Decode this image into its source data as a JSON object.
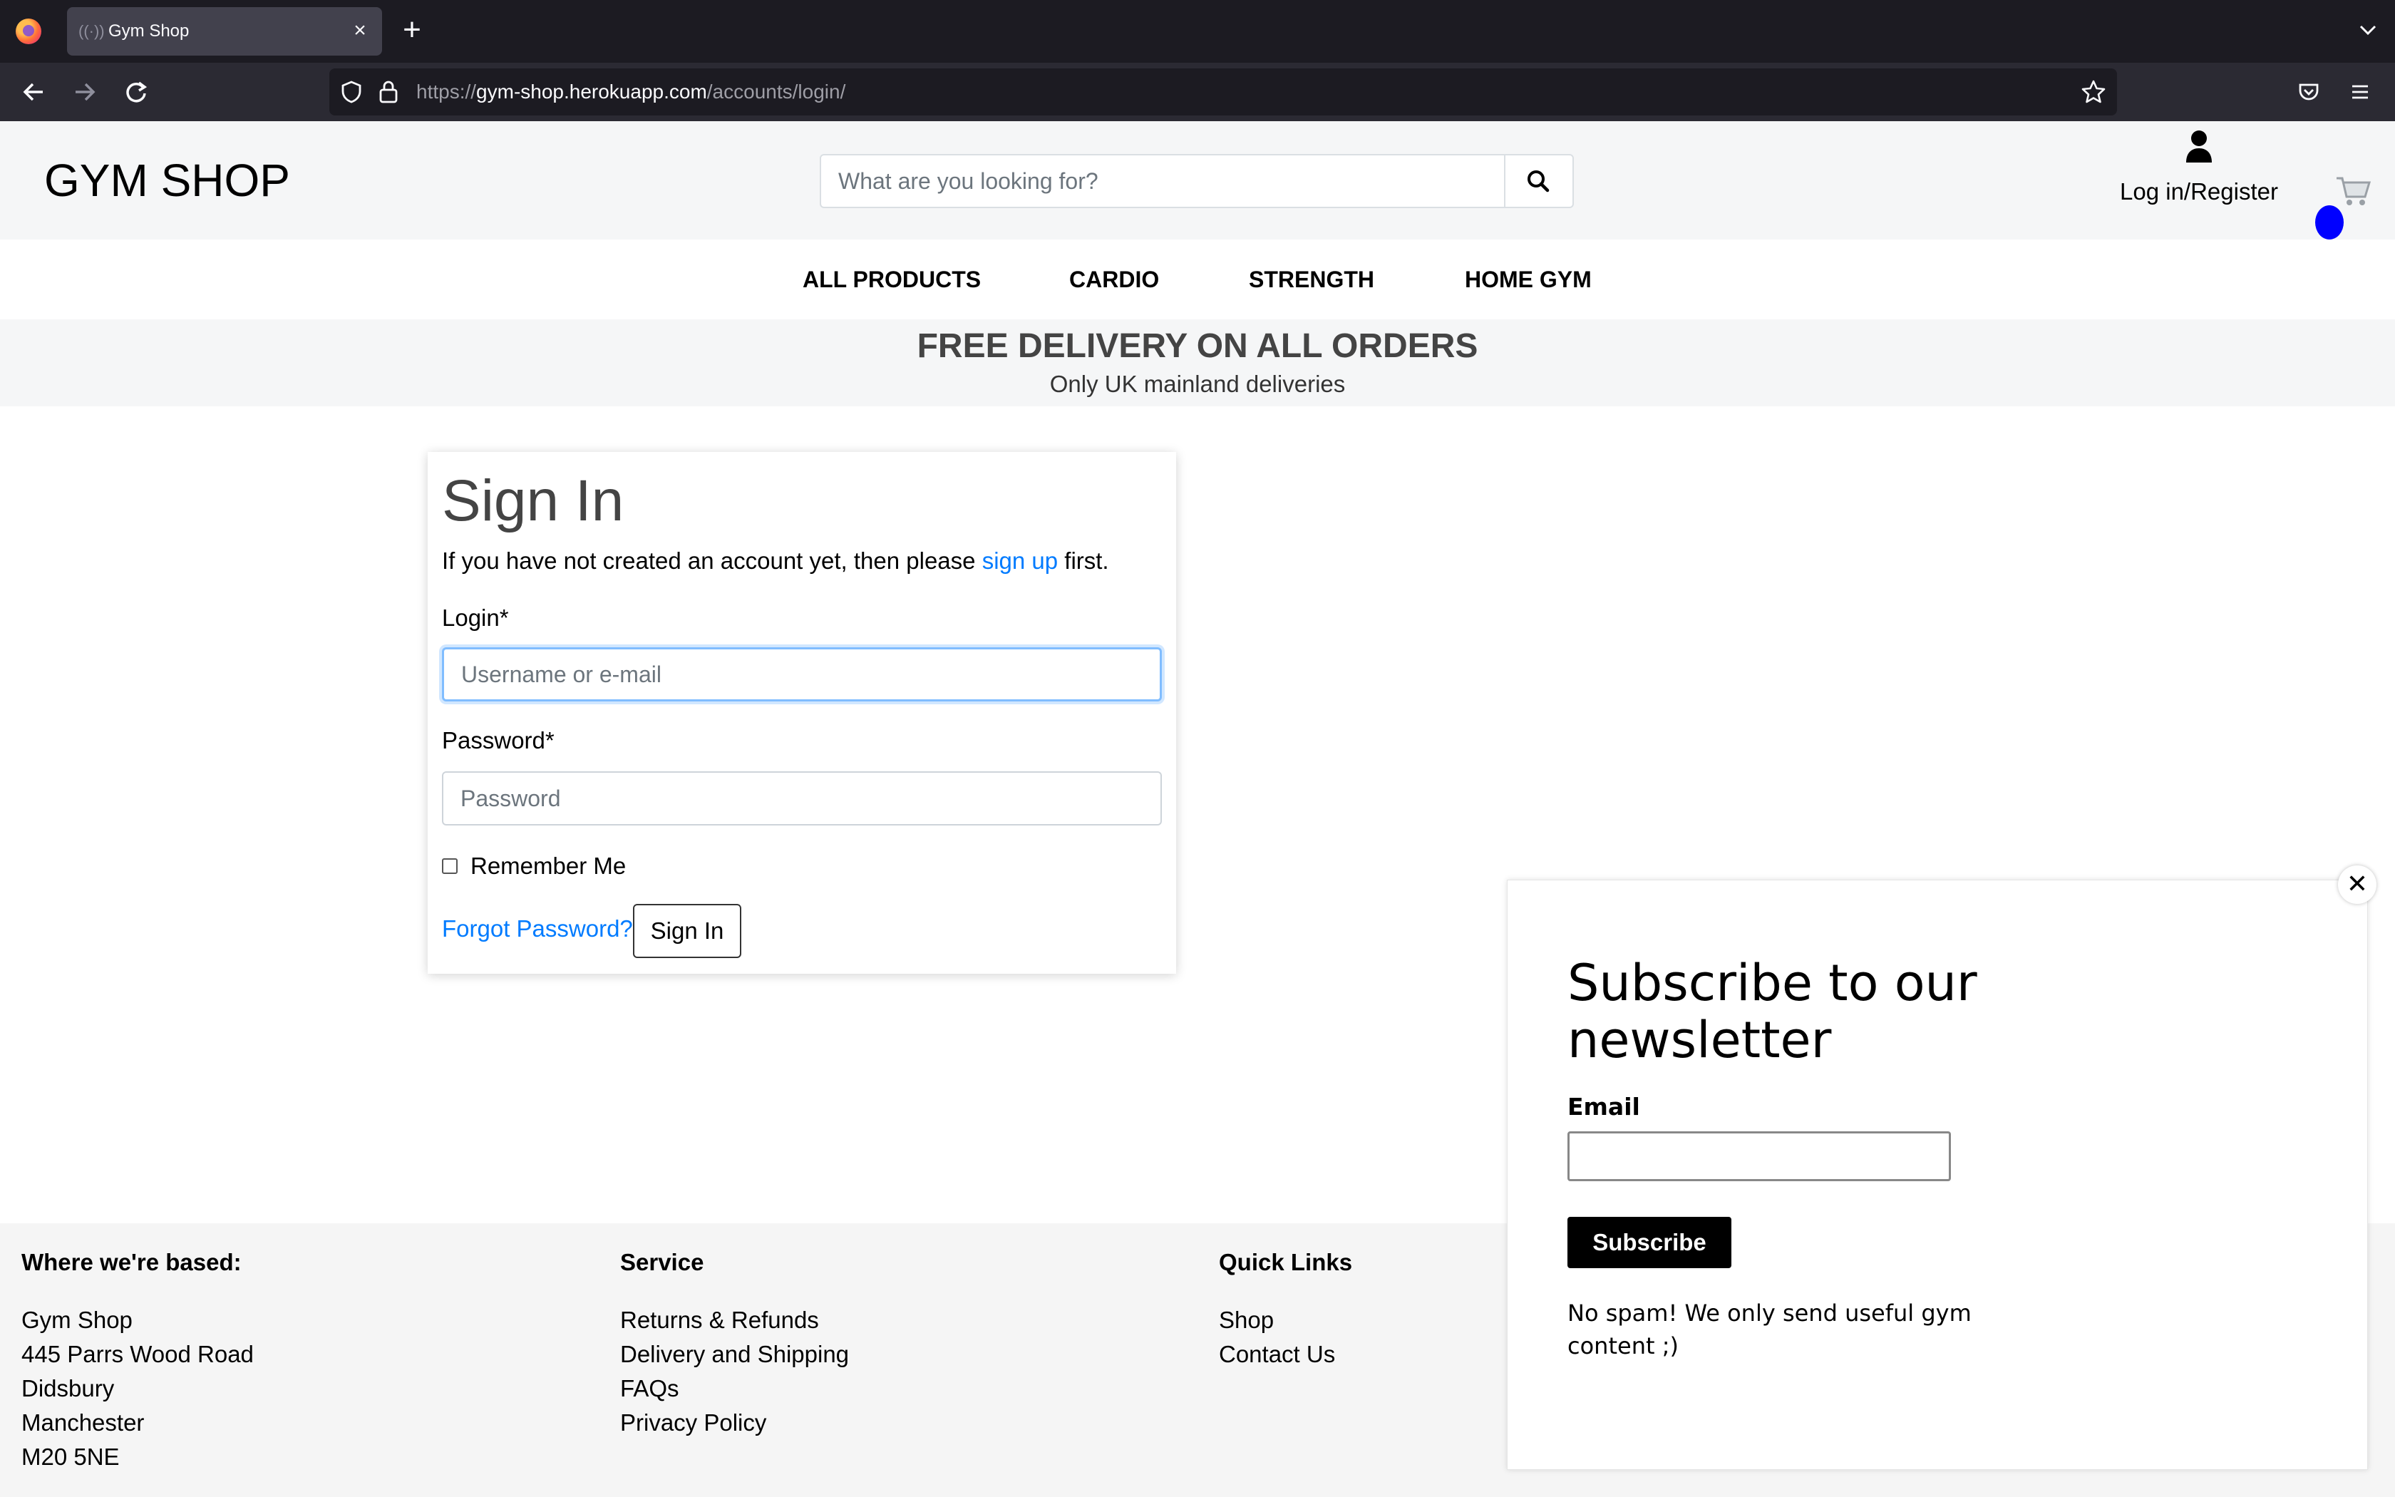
{
  "browser": {
    "tab_title": "Gym Shop",
    "url_prefix": "https://",
    "url_domain": "gym-shop.herokuapp.com",
    "url_path": "/accounts/login/"
  },
  "header": {
    "logo": "GYM SHOP",
    "search_placeholder": "What are you looking for?",
    "account_label": "Log in/Register"
  },
  "nav": {
    "items": [
      "ALL PRODUCTS",
      "CARDIO",
      "STRENGTH",
      "HOME GYM"
    ]
  },
  "banner": {
    "title": "FREE DELIVERY ON ALL ORDERS",
    "subtitle": "Only UK mainland deliveries"
  },
  "signin": {
    "title": "Sign In",
    "intro_before": "If you have not created an account yet, then please ",
    "intro_link": "sign up",
    "intro_after": " first.",
    "login_label": "Login*",
    "login_placeholder": "Username or e-mail",
    "password_label": "Password*",
    "password_placeholder": "Password",
    "remember_label": "Remember Me",
    "forgot_label": "Forgot Password?",
    "submit_label": "Sign In"
  },
  "footer": {
    "col1": {
      "heading": "Where we're based:",
      "lines": [
        "Gym Shop",
        "445 Parrs Wood Road",
        "Didsbury",
        "Manchester",
        "M20 5NE"
      ]
    },
    "col2": {
      "heading": "Service",
      "links": [
        "Returns & Refunds",
        "Delivery and Shipping",
        "FAQs",
        "Privacy Policy"
      ]
    },
    "col3": {
      "heading": "Quick Links",
      "links": [
        "Shop",
        "Contact Us"
      ]
    }
  },
  "newsletter": {
    "title": "Subscribe to our newsletter",
    "email_label": "Email",
    "button_label": "Subscribe",
    "note": "No spam! We only send useful gym content ;)",
    "close_symbol": "✕"
  },
  "colors": {
    "link": "#007bff",
    "cart_badge": "#0000ff",
    "chrome_dark": "#1c1b22"
  },
  "icons": [
    "firefox-logo-icon",
    "tab-favicon-icon",
    "close-icon",
    "plus-icon",
    "chevron-down-icon",
    "back-arrow-icon",
    "forward-arrow-icon",
    "reload-icon",
    "shield-icon",
    "lock-icon",
    "star-icon",
    "pocket-icon",
    "menu-icon",
    "search-icon",
    "user-icon",
    "cart-icon"
  ]
}
